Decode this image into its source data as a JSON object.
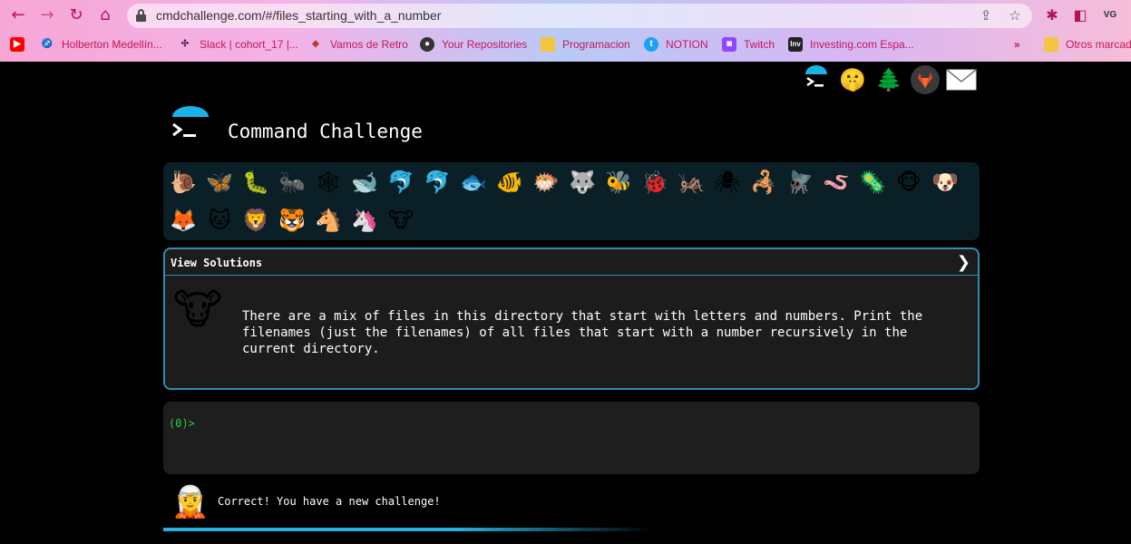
{
  "browser": {
    "url": "cmdchallenge.com/#/files_starting_with_a_number",
    "bookmarks": [
      {
        "label": "",
        "icon": "youtube-icon",
        "color": "#ff0000"
      },
      {
        "label": "Holberton Medellín...",
        "icon": "holberton-icon",
        "color": "#e0245e"
      },
      {
        "label": "Slack | cohort_17 |...",
        "icon": "slack-icon",
        "color": "#4a154b"
      },
      {
        "label": "Vamos de Retro",
        "icon": "retro-icon",
        "color": "#b83b2e"
      },
      {
        "label": "Your Repositories",
        "icon": "github-icon",
        "color": "#333333"
      },
      {
        "label": "Programacion",
        "icon": "folder-icon",
        "color": "#f5c542"
      },
      {
        "label": "NOTION",
        "icon": "twitter-icon",
        "color": "#1da1f2"
      },
      {
        "label": "Twitch",
        "icon": "twitch-icon",
        "color": "#9146ff"
      },
      {
        "label": "Investing.com Espa...",
        "icon": "investing-icon",
        "color": "#222222"
      },
      {
        "label": "Otros marcado",
        "icon": "folder-icon",
        "color": "#f5c542"
      }
    ]
  },
  "header": {
    "title": "Command Challenge"
  },
  "animals": [
    "🐌",
    "🦋",
    "🐛",
    "🐜",
    "🕸",
    "🐋",
    "🐬",
    "🐬",
    "🐟",
    "🐠",
    "🐡",
    "🐺",
    "🐝",
    "🐞",
    "🦗",
    "🕷",
    "🦂",
    "🪰",
    "🪱",
    "🦠",
    "🐵",
    "🐶",
    "🦊",
    "🐱",
    "🦁",
    "🐯",
    "🐴",
    "🦄",
    "🐮"
  ],
  "challenge": {
    "view_solutions": "View Solutions",
    "chevron": "❯",
    "avatar": "🐮",
    "description": "There are a mix of files in this directory that start with letters and numbers. Print the filenames (just the filenames) of all files that start with a number recursively in the current directory."
  },
  "terminal": {
    "prompt": "(0)>"
  },
  "status": {
    "avatar": "🧝",
    "message": "Correct! You have a new challenge!"
  }
}
